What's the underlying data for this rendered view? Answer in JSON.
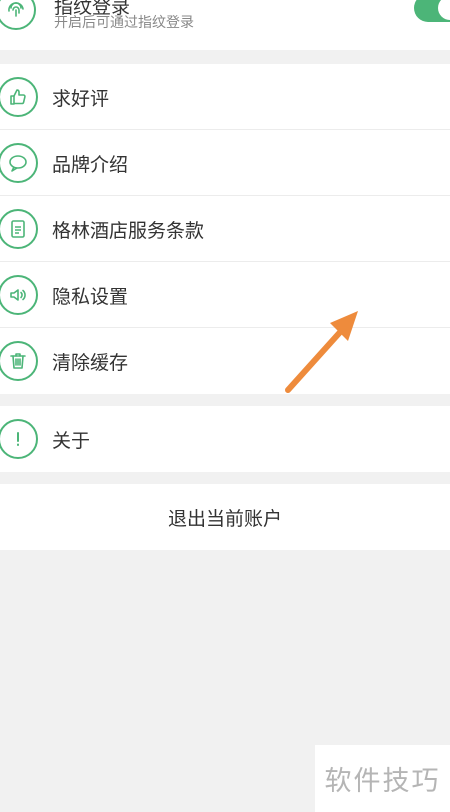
{
  "fingerprint": {
    "title": "指纹登录",
    "subtitle": "开启后可通过指纹登录",
    "icon": "fingerprint-icon",
    "enabled": true
  },
  "menu": [
    {
      "label": "求好评",
      "icon": "thumbs-up-icon"
    },
    {
      "label": "品牌介绍",
      "icon": "speech-bubble-icon"
    },
    {
      "label": "格林酒店服务条款",
      "icon": "document-icon"
    },
    {
      "label": "隐私设置",
      "icon": "speaker-icon"
    },
    {
      "label": "清除缓存",
      "icon": "trash-icon"
    }
  ],
  "about": {
    "label": "关于",
    "icon": "info-exclamation-icon"
  },
  "logout": {
    "label": "退出当前账户"
  },
  "watermark": "软件技巧",
  "colors": {
    "accent": "#4cb578",
    "background": "#f1f1f1",
    "arrow": "#ee8b3c"
  }
}
